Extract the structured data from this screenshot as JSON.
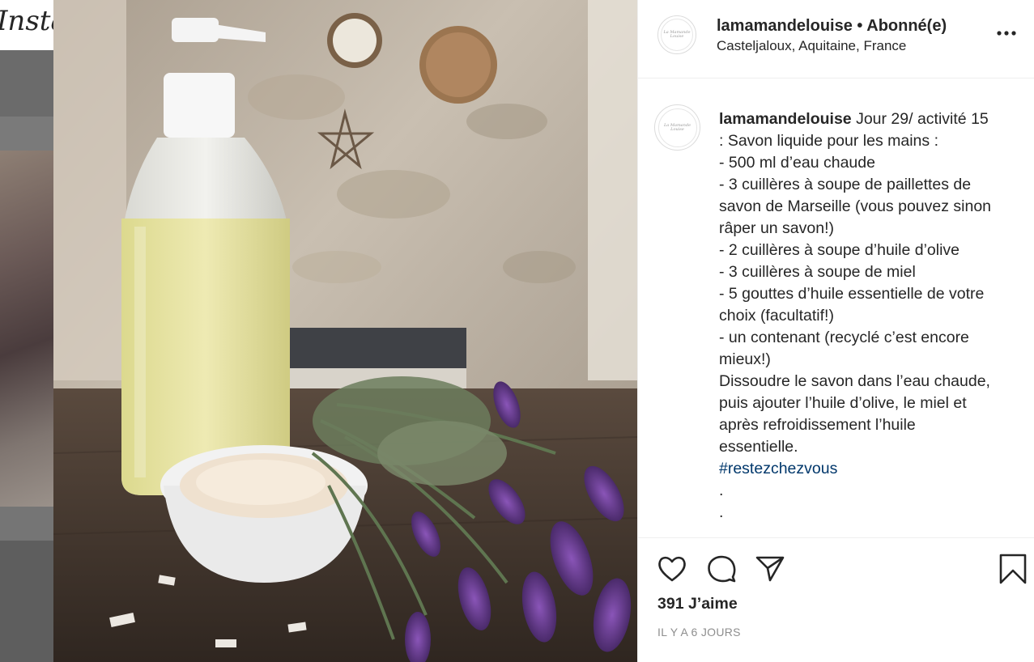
{
  "background_page": {
    "logo_text": "Instagram"
  },
  "post": {
    "username": "lamamandelouise",
    "header_separator": "•",
    "follow_status": "Abonné(e)",
    "location": "Casteljaloux, Aquitaine, France",
    "avatar_text": "La Mamande Louise",
    "caption_lines": [
      "Jour 29/ activité 15",
      ": Savon liquide pour les mains :",
      "- 500 ml d’eau chaude",
      "- 3 cuillères à soupe de paillettes de",
      "savon de Marseille (vous pouvez sinon",
      "râper un savon!)",
      "- 2 cuillères à soupe d’huile d’olive",
      "- 3 cuillères à soupe de miel",
      "- 5 gouttes d’huile essentielle de votre",
      "choix (facultatif!)",
      "- un contenant (recyclé c’est encore",
      "mieux!)",
      "Dissoudre le savon dans l’eau chaude,",
      "puis ajouter l’huile d’olive, le miel et",
      "après refroidissement l’huile",
      "essentielle."
    ],
    "hashtag": "#restezchezvous",
    "dots": [
      ".",
      "."
    ],
    "likes": "391 J’aime",
    "timestamp": "IL Y A 6 JOURS"
  },
  "icons": {
    "more": "more-options-icon",
    "like": "heart-icon",
    "comment": "comment-icon",
    "share": "paper-plane-icon",
    "save": "bookmark-icon"
  },
  "colors": {
    "text": "#262626",
    "muted": "#8e8e8e",
    "hashtag": "#00376b",
    "divider": "#efefef"
  }
}
